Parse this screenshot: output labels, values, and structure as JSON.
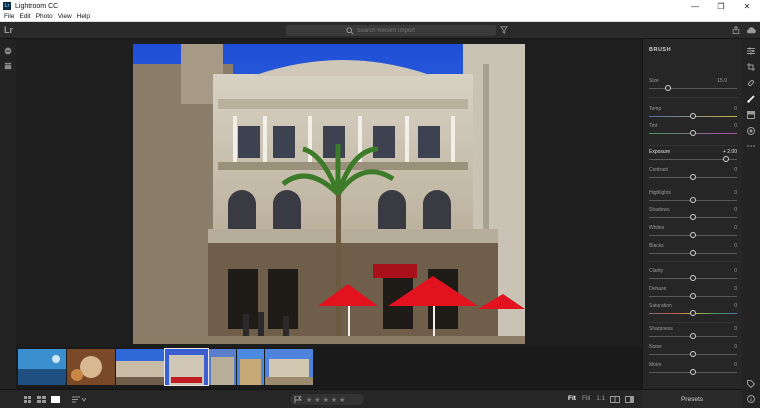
{
  "window": {
    "title": "Lightroom CC",
    "app_icon_text": "Lr"
  },
  "window_controls": {
    "minimize": "—",
    "maximize": "❐",
    "close": "✕"
  },
  "menu": [
    "File",
    "Edit",
    "Photo",
    "View",
    "Help"
  ],
  "header": {
    "logo": "Lr",
    "search_placeholder": "Search Recent Import",
    "icons": [
      "filter-icon",
      "share-icon",
      "cloud-icon"
    ]
  },
  "left_strip_icons": [
    "add-photo-icon",
    "library-icon"
  ],
  "panel": {
    "title": "BRUSH",
    "size_label": "Size",
    "size_value": "15.0",
    "sliders_group1": [
      {
        "label": "Temp",
        "value": "0",
        "level": 0.5
      },
      {
        "label": "Tint",
        "value": "0",
        "level": 0.5
      }
    ],
    "exposure": {
      "label": "Exposure",
      "value": "+ 2.00",
      "level": 0.9
    },
    "sliders_group2": [
      {
        "label": "Contrast",
        "value": "0",
        "level": 0.5
      },
      {
        "label": "Highlights",
        "value": "0",
        "level": 0.5
      },
      {
        "label": "Shadows",
        "value": "0",
        "level": 0.5
      },
      {
        "label": "Whites",
        "value": "0",
        "level": 0.5
      },
      {
        "label": "Blacks",
        "value": "0",
        "level": 0.5
      }
    ],
    "sliders_group3": [
      {
        "label": "Clarity",
        "value": "0",
        "level": 0.5
      },
      {
        "label": "Dehaze",
        "value": "0",
        "level": 0.5
      },
      {
        "label": "Saturation",
        "value": "0",
        "level": 0.5
      }
    ],
    "sliders_group4": [
      {
        "label": "Sharpness",
        "value": "0",
        "level": 0.5
      },
      {
        "label": "Noise",
        "value": "0",
        "level": 0.5
      },
      {
        "label": "Moire",
        "value": "0",
        "level": 0.5
      }
    ],
    "presets_label": "Presets"
  },
  "bottom": {
    "fit_options": [
      "Fit",
      "Fill",
      "1:1"
    ],
    "active_fit": "Fit",
    "rating_stars": [
      "★",
      "★",
      "★",
      "★",
      "★"
    ],
    "view_icons": [
      "grid-view-icon",
      "square-grid-icon",
      "single-view-icon",
      "sort-icon",
      "flag-icon",
      "compare-icon",
      "info-icon"
    ]
  },
  "right_tools": [
    "edit-sliders-icon",
    "crop-icon",
    "healing-icon",
    "brush-icon",
    "linear-gradient-icon",
    "radial-gradient-icon",
    "more-icon",
    "tag-icon",
    "info-icon"
  ],
  "filmstrip": {
    "thumb_count": 7,
    "selected_index": 3
  },
  "colors": {
    "accent": "#ffffff",
    "panel_bg": "#262626",
    "canvas_bg": "#1e1e1e"
  }
}
